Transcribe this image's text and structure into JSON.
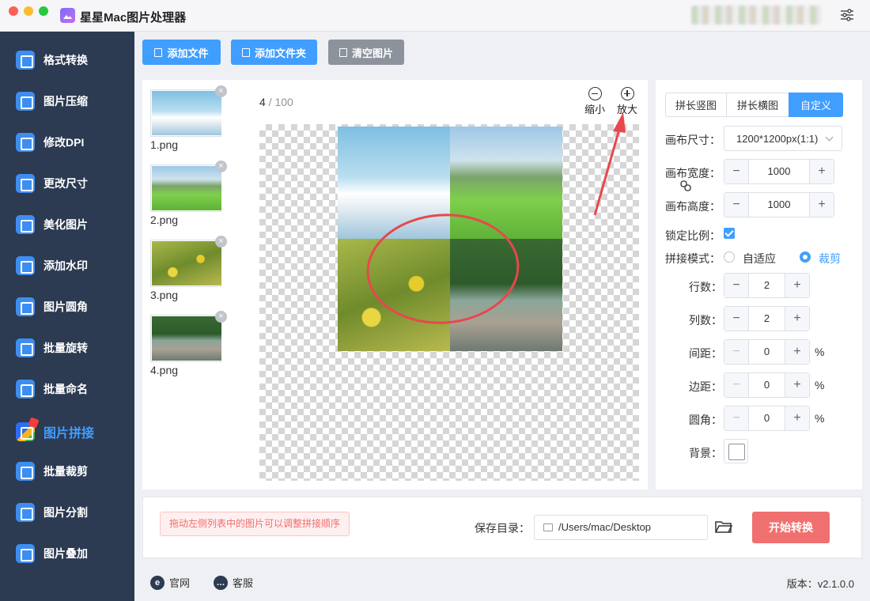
{
  "window": {
    "title": "星星Mac图片处理器"
  },
  "sidebar": {
    "items": [
      {
        "label": "格式转换",
        "icon": "format-convert-icon"
      },
      {
        "label": "图片压缩",
        "icon": "compress-icon"
      },
      {
        "label": "修改DPI",
        "icon": "dpi-icon"
      },
      {
        "label": "更改尺寸",
        "icon": "resize-icon"
      },
      {
        "label": "美化图片",
        "icon": "beautify-icon"
      },
      {
        "label": "添加水印",
        "icon": "watermark-icon"
      },
      {
        "label": "图片圆角",
        "icon": "round-corner-icon"
      },
      {
        "label": "批量旋转",
        "icon": "rotate-icon"
      },
      {
        "label": "批量命名",
        "icon": "rename-icon"
      },
      {
        "label": "图片拼接",
        "icon": "stitch-icon",
        "active": true
      },
      {
        "label": "批量裁剪",
        "icon": "crop-icon"
      },
      {
        "label": "图片分割",
        "icon": "split-icon"
      },
      {
        "label": "图片叠加",
        "icon": "overlay-icon"
      }
    ]
  },
  "toolbar": {
    "add_file": "添加文件",
    "add_folder": "添加文件夹",
    "clear": "清空图片"
  },
  "files": [
    {
      "name": "1.png"
    },
    {
      "name": "2.png"
    },
    {
      "name": "3.png"
    },
    {
      "name": "4.png"
    }
  ],
  "preview": {
    "current": "4",
    "separator": "/",
    "total": "100",
    "zoom_out": "缩小",
    "zoom_in": "放大"
  },
  "settings": {
    "tabs": [
      "拼长竖图",
      "拼长横图",
      "自定义"
    ],
    "active_tab": "自定义",
    "canvas_size_label": "画布尺寸：",
    "canvas_size_value": "1200*1200px(1:1)",
    "width_label": "画布宽度：",
    "width_value": "1000",
    "height_label": "画布高度：",
    "height_value": "1000",
    "lock_label": "锁定比例：",
    "lock_checked": true,
    "mode_label": "拼接模式：",
    "mode_options": [
      "自适应",
      "裁剪"
    ],
    "mode_selected": "裁剪",
    "rows_label": "行数：",
    "rows_value": "2",
    "cols_label": "列数：",
    "cols_value": "2",
    "spacing_label": "间距：",
    "spacing_value": "0",
    "margin_label": "边距：",
    "margin_value": "0",
    "radius_label": "圆角：",
    "radius_value": "0",
    "percent": "%",
    "bg_label": "背景："
  },
  "bottom": {
    "hint": "拖动左侧列表中的图片可以调整拼接顺序",
    "save_label": "保存目录：",
    "save_path": "/Users/mac/Desktop",
    "start": "开始转换"
  },
  "footer": {
    "website": "官网",
    "support": "客服",
    "version": "版本：v2.1.0.0"
  },
  "colors": {
    "accent": "#409eff",
    "sidebar": "#2c3a52",
    "start": "#f07070",
    "annotation": "#e8474d"
  }
}
